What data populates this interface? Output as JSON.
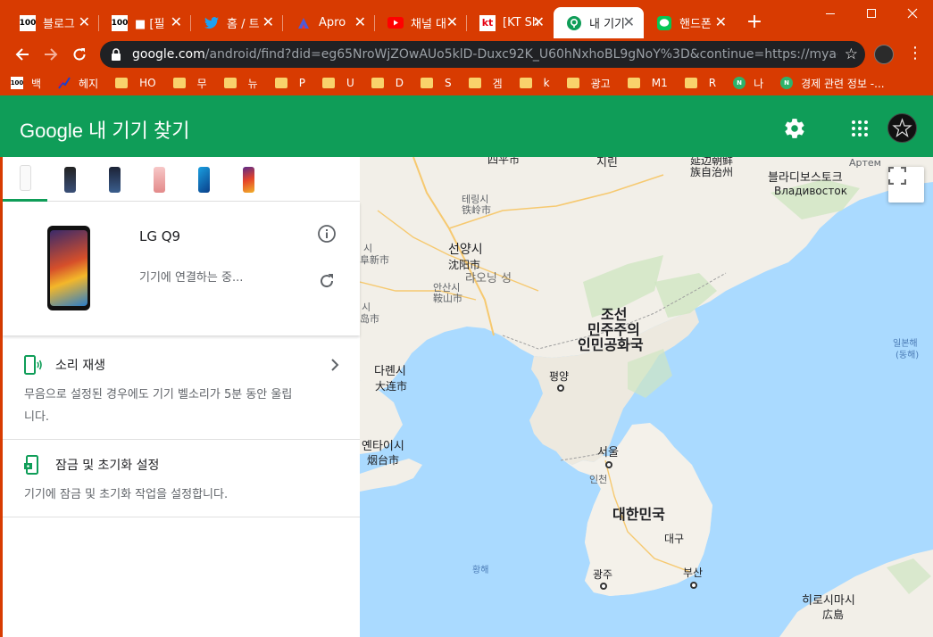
{
  "browser": {
    "tabs": [
      {
        "title": "블로그",
        "favicon": "100-icon",
        "active": false
      },
      {
        "title": "■ [필",
        "favicon": "100-icon",
        "active": false
      },
      {
        "title": "홈 / 트",
        "favicon": "twitter-icon",
        "active": false
      },
      {
        "title": "Apro",
        "favicon": "apro-icon",
        "active": false
      },
      {
        "title": "채널 대",
        "favicon": "youtube-icon",
        "active": false
      },
      {
        "title": "[KT Sh",
        "favicon": "kt-icon",
        "active": false
      },
      {
        "title": "내 기기",
        "favicon": "find-device-icon",
        "active": true
      },
      {
        "title": "핸드폰",
        "favicon": "line-icon",
        "active": false
      }
    ],
    "favicon_text": "100",
    "kt_text": "kt",
    "new_tab": "+",
    "close_glyph": "✕",
    "url_host": "google.com",
    "url_path": "/android/find?did=eg65NroWjZOwAUo5klD-Duxc92K_U60hNxhoBL9gNoY%3D&continue=https://myaccount....",
    "bookmarks": [
      {
        "label": "백",
        "icon": "100-icon"
      },
      {
        "label": "헤지",
        "icon": "chart-icon"
      },
      {
        "label": "HO",
        "icon": "folder-icon"
      },
      {
        "label": "무",
        "icon": "folder-icon"
      },
      {
        "label": "뉴",
        "icon": "folder-icon"
      },
      {
        "label": "P",
        "icon": "folder-icon"
      },
      {
        "label": "U",
        "icon": "folder-icon"
      },
      {
        "label": "D",
        "icon": "folder-icon"
      },
      {
        "label": "S",
        "icon": "folder-icon"
      },
      {
        "label": "겜",
        "icon": "folder-icon"
      },
      {
        "label": "k",
        "icon": "folder-icon"
      },
      {
        "label": "광고",
        "icon": "folder-icon"
      },
      {
        "label": "M1",
        "icon": "folder-icon"
      },
      {
        "label": "R",
        "icon": "folder-icon"
      },
      {
        "label": "나",
        "icon": "naver-icon"
      },
      {
        "label": "경제 관련 정보 -...",
        "icon": "naver-icon"
      }
    ],
    "naver_text": "N"
  },
  "app": {
    "title": "Google 내 기기 찾기",
    "brand_color": "#0f9d58"
  },
  "device": {
    "name": "LG Q9",
    "status": "기기에 연결하는 중..."
  },
  "actions": [
    {
      "title": "소리 재생",
      "description": "무음으로 설정된 경우에도 기기 벨소리가 5분 동안 울립니다."
    },
    {
      "title": "잠금 및 초기화 설정",
      "description": "기기에 잠금 및 초기화 작업을 설정합니다."
    }
  ],
  "map": {
    "labels": {
      "sipingshi": "四平市",
      "jilin": "지린",
      "yanbian": "延边朝鲜",
      "yanbian2": "族自治州",
      "artem": "Артем",
      "vladivostok_ko": "블라디보스토크",
      "vladivostok_ru": "Владивосток",
      "tieling_ko": "테링시",
      "tieling_cn": "铁岭市",
      "shenyang_ko": "선양시",
      "shenyang_cn": "沈阳市",
      "fuzhou_ko": "시",
      "fuzhou_cn": "阜新市",
      "liaoning": "랴오닝 성",
      "anshan_ko": "안산시",
      "anshan_cn": "鞍山市",
      "huludao_ko": "시",
      "huludao_cn": "岛市",
      "nk_1": "조선",
      "nk_2": "민주주의",
      "nk_3": "인민공화국",
      "east_sea_1": "일본해",
      "east_sea_2": "(동해)",
      "dalian_ko": "다롄시",
      "dalian_cn": "大连市",
      "pyongyang": "평양",
      "yantai_ko": "옌타이시",
      "yantai_cn": "烟台市",
      "seoul": "서울",
      "incheon": "인천",
      "sk": "대한민국",
      "daegu": "대구",
      "yellow_sea": "황해",
      "gwangju": "광주",
      "busan": "부산",
      "hiroshima_ko": "히로시마시",
      "hiroshima_jp": "広島"
    }
  }
}
